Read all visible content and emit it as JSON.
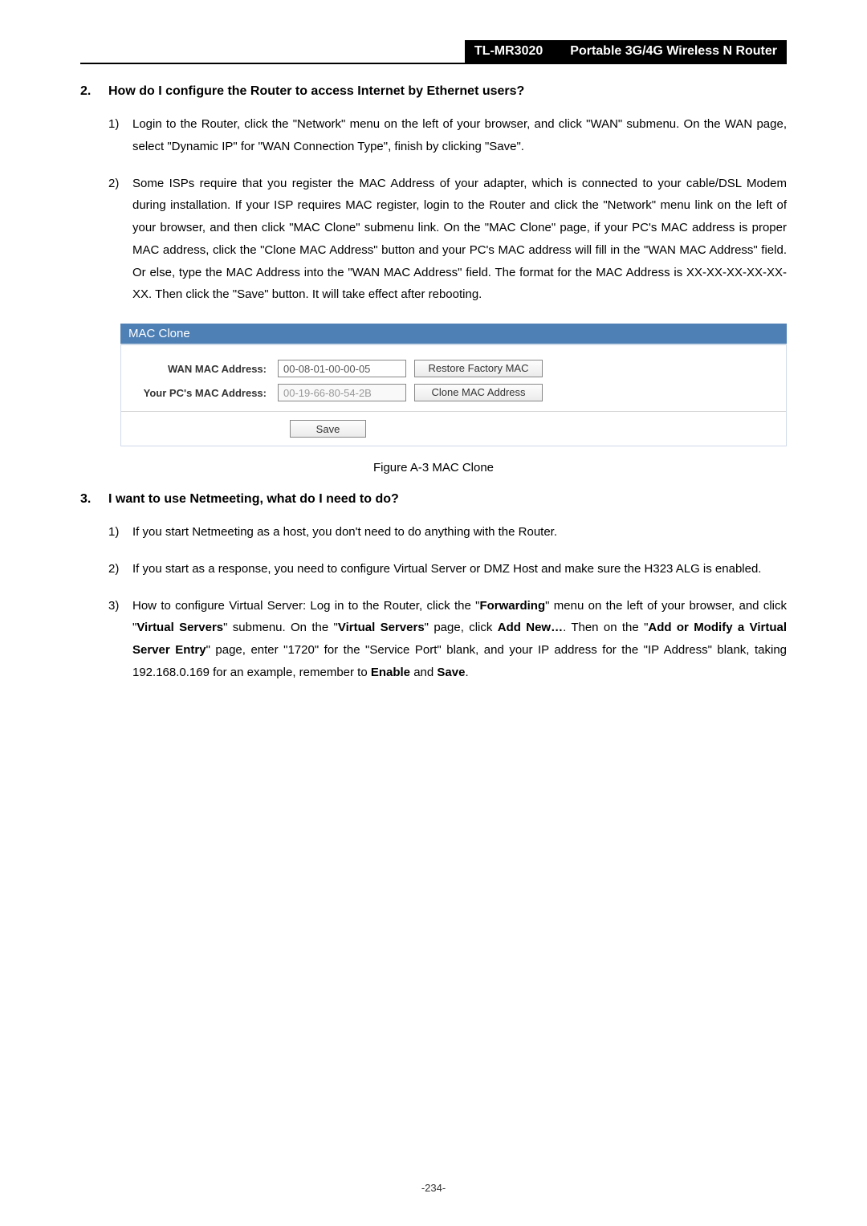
{
  "header": {
    "model": "TL-MR3020",
    "title": "Portable 3G/4G Wireless N Router"
  },
  "section2": {
    "num": "2.",
    "title": "How do I configure the Router to access Internet by Ethernet users?",
    "step1num": "1)",
    "step1": "Login to the Router, click the \"Network\" menu on the left of your browser, and click \"WAN\" submenu. On the WAN page, select \"Dynamic IP\" for \"WAN Connection Type\", finish by clicking \"Save\".",
    "step2num": "2)",
    "step2": "Some ISPs require that you register the MAC Address of your adapter, which is connected to your cable/DSL Modem during installation. If your ISP requires MAC register, login to the Router and click the \"Network\" menu link on the left of your browser, and then click \"MAC Clone\" submenu link. On the \"MAC Clone\" page, if your PC's MAC address is proper MAC address, click the \"Clone MAC Address\" button and your PC's MAC address will fill in the \"WAN MAC Address\" field. Or else, type the MAC Address into the \"WAN MAC Address\" field. The format for the MAC Address is XX-XX-XX-XX-XX-XX. Then click the \"Save\" button. It will take effect after rebooting."
  },
  "figure": {
    "panelTitle": "MAC Clone",
    "wanLabel": "WAN MAC Address:",
    "wanValue": "00-08-01-00-00-05",
    "restoreBtn": "Restore Factory MAC",
    "pcLabel": "Your PC's MAC Address:",
    "pcValue": "00-19-66-80-54-2B",
    "cloneBtn": "Clone MAC Address",
    "saveBtn": "Save",
    "caption": "Figure A-3    MAC Clone"
  },
  "section3": {
    "num": "3.",
    "title": "I want to use Netmeeting, what do I need to do?",
    "step1num": "1)",
    "step1": "If you start Netmeeting as a host, you don't need to do anything with the Router.",
    "step2num": "2)",
    "step2": "If you start as a response, you need to configure Virtual Server or DMZ Host and make sure the H323 ALG is enabled.",
    "step3num": "3)",
    "step3a": "How to configure Virtual Server: Log in to the Router, click the \"",
    "step3b_bold": "Forwarding",
    "step3c": "\" menu on the left of your browser, and click \"",
    "step3d_bold": "Virtual Servers",
    "step3e": "\" submenu. On the \"",
    "step3f_bold": "Virtual Servers",
    "step3g": "\" page, click ",
    "step3h_bold": "Add New…",
    "step3i": ". Then on the \"",
    "step3j_bold": "Add or Modify a Virtual Server Entry",
    "step3k": "\" page, enter \"1720\" for the \"Service Port\" blank, and your IP address for the \"IP Address\" blank, taking 192.168.0.169 for an example, remember to ",
    "step3l_bold": "Enable",
    "step3m": " and ",
    "step3n_bold": "Save",
    "step3o": "."
  },
  "pageNum": "-234-"
}
